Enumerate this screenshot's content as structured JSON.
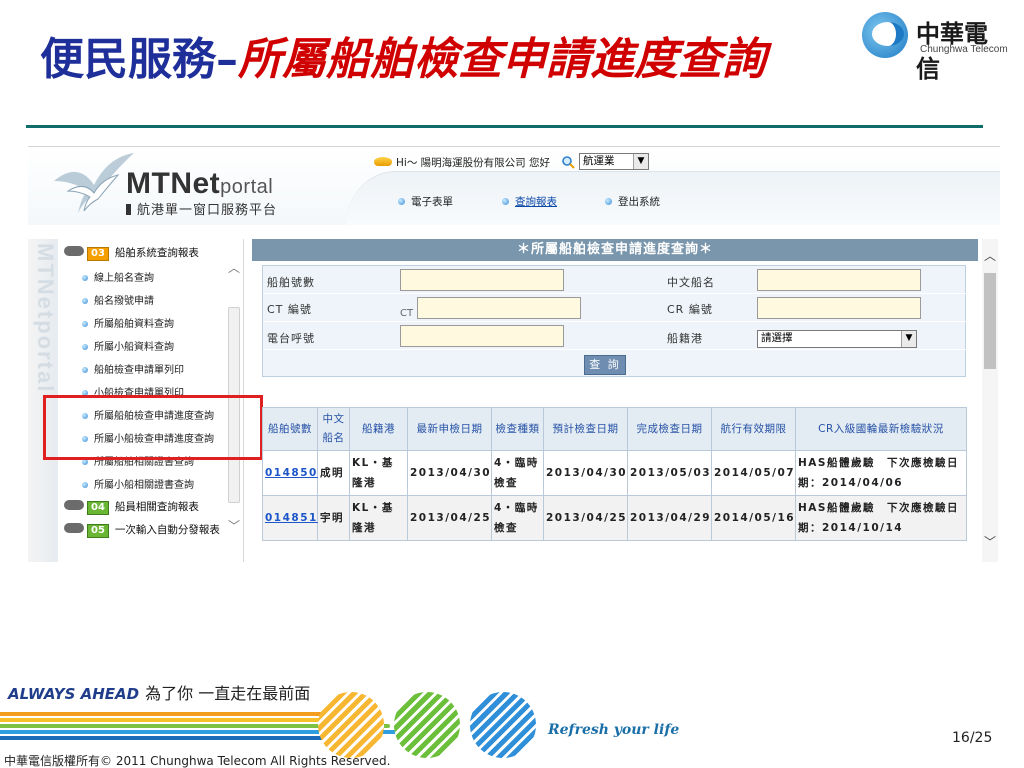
{
  "slide": {
    "title_blue": "便民服務",
    "title_dash": "–",
    "title_red": "所屬船舶檢查申請進度查詢",
    "brand_name": "中華電信",
    "brand_sub": "Chunghwa Telecom",
    "page_number": "16/25",
    "copyright": "中華電信版權所有© 2011 Chunghwa Telecom All Rights Reserved.",
    "slogan_en": "ALWAYS AHEAD",
    "slogan_cn": "為了你 一直走在最前面",
    "tagline": "Refresh your life"
  },
  "portal": {
    "logo_main": "MTNet",
    "logo_portal": "portal",
    "logo_sub": "航港單一窗口服務平台",
    "greeting": "Hi～ 陽明海運股份有限公司 您好",
    "business_select": "航運業",
    "nav": [
      {
        "label": "電子表單"
      },
      {
        "label": "查詢報表"
      },
      {
        "label": "登出系統"
      }
    ],
    "vertical_brand": "MTNetportal"
  },
  "sidebar": {
    "groups": [
      {
        "num": "03",
        "label": "船舶系統查詢報表"
      },
      {
        "num": "04",
        "label": "船員相關查詢報表"
      },
      {
        "num": "05",
        "label": "一次輸入自動分發報表"
      }
    ],
    "items": [
      {
        "label": "線上船名查詢"
      },
      {
        "label": "船名撥號申請"
      },
      {
        "label": "所屬船舶資料查詢"
      },
      {
        "label": "所屬小船資料查詢"
      },
      {
        "label": "船舶檢查申請單列印"
      },
      {
        "label": "小船檢查申請單列印"
      },
      {
        "label": "所屬船舶檢查申請進度查詢"
      },
      {
        "label": "所屬小船檢查申請進度查詢"
      },
      {
        "label": "所屬船舶相關證書查詢"
      },
      {
        "label": "所屬小船相關證書查詢"
      }
    ]
  },
  "main": {
    "panel_title": "＊所屬船舶檢查申請進度查詢＊",
    "form": {
      "ship_no_label": "船舶號數",
      "cn_name_label": "中文船名",
      "ct_label": "CT 編號",
      "ct_prefix": "CT",
      "cr_label": "CR 編號",
      "call_sign_label": "電台呼號",
      "port_label": "船籍港",
      "port_select": "請選擇",
      "query_button": "查 詢"
    },
    "table": {
      "headers": [
        "船舶號數",
        "中文船名",
        "船籍港",
        "最新申檢日期",
        "檢查種類",
        "預計檢查日期",
        "完成檢查日期",
        "航行有效期限",
        "CR入級國輪最新檢驗狀況"
      ],
      "rows": [
        [
          "014850",
          "成明",
          "KL・基隆港",
          "2013/04/30",
          "4・臨時檢查",
          "2013/04/30",
          "2013/05/03",
          "2014/05/07",
          "HAS船體歲驗　下次應檢驗日期：2014/04/06"
        ],
        [
          "014851",
          "宇明",
          "KL・基隆港",
          "2013/04/25",
          "4・臨時檢查",
          "2013/04/25",
          "2013/04/29",
          "2014/05/16",
          "HAS船體歲驗　下次應檢驗日期：2014/10/14"
        ]
      ]
    }
  },
  "colors": {
    "title_blue": "#1f2f9a",
    "title_red": "#d00000",
    "accent_teal": "#0f6e6a",
    "panel_header": "#7996ad",
    "highlight": "#e02020",
    "link": "#1c56c9"
  }
}
